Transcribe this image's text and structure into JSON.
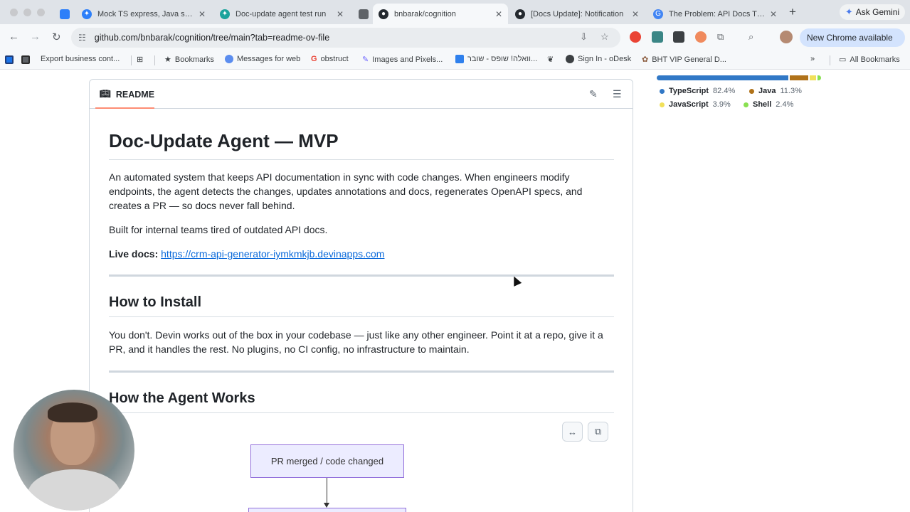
{
  "browser": {
    "tabs": [
      {
        "title": "Mock TS express, Java sprin",
        "favicon_color": "#2d7ff9",
        "active": false
      },
      {
        "title": "Doc-update agent test run",
        "favicon_color": "#1aa39c",
        "active": false
      },
      {
        "title": "",
        "favicon_color": "#5f6368",
        "active": false
      },
      {
        "title": "bnbarak/cognition",
        "favicon_color": "#24292f",
        "active": true
      },
      {
        "title": "[Docs Update]: Notification",
        "favicon_color": "#24292f",
        "active": false
      },
      {
        "title": "The Problem: API Docs Tha",
        "favicon_color": "#4285f4",
        "active": false
      }
    ],
    "new_tab": "+",
    "gemini_label": "Ask Gemini",
    "url": "github.com/bnbarak/cognition/tree/main?tab=readme-ov-file",
    "new_chrome_label": "New Chrome available",
    "bookmarks": [
      {
        "label": "Export business cont...",
        "color": "#8a8d91"
      },
      {
        "label": "",
        "color": "#c4c7cc"
      },
      {
        "label": "Bookmarks",
        "color": "#5f6368"
      },
      {
        "label": "Messages for web",
        "color": "#5b8def"
      },
      {
        "label": "obstruct",
        "color": "#ea4335"
      },
      {
        "label": "Images and Pixels...",
        "color": "#6c63ff"
      },
      {
        "label": "וואלה! שופס - שובר...",
        "color": "#2f80ed"
      },
      {
        "label": "",
        "color": "#6d6d6d"
      },
      {
        "label": "Sign In - oDesk",
        "color": "#3c4043"
      },
      {
        "label": "BHT VIP General D...",
        "color": "#8a5a3c"
      }
    ],
    "all_bookmarks_label": "All Bookmarks"
  },
  "readme": {
    "tab_label": "README",
    "title": "Doc-Update Agent — MVP",
    "intro": "An automated system that keeps API documentation in sync with code changes. When engineers modify endpoints, the agent detects the changes, updates annotations and docs, regenerates OpenAPI specs, and creates a PR — so docs never fall behind.",
    "built_for": "Built for internal teams tired of outdated API docs.",
    "live_docs_label": "Live docs:",
    "live_docs_url": "https://crm-api-generator-iymkmkjb.devinapps.com",
    "install_heading": "How to Install",
    "install_text": "You don't. Devin works out of the box in your codebase — just like any other engineer. Point it at a repo, give it a PR, and it handles the rest. No plugins, no CI config, no infrastructure to maintain.",
    "agent_heading": "How the Agent Works",
    "diagram_node_1": "PR merged / code changed"
  },
  "languages": [
    {
      "name": "TypeScript",
      "percent": "82.4%",
      "share": 82.4,
      "color": "#3178c6"
    },
    {
      "name": "Java",
      "percent": "11.3%",
      "share": 11.3,
      "color": "#b07219"
    },
    {
      "name": "JavaScript",
      "percent": "3.9%",
      "share": 3.9,
      "color": "#f1e05a"
    },
    {
      "name": "Shell",
      "percent": "2.4%",
      "share": 2.4,
      "color": "#89e051"
    }
  ]
}
